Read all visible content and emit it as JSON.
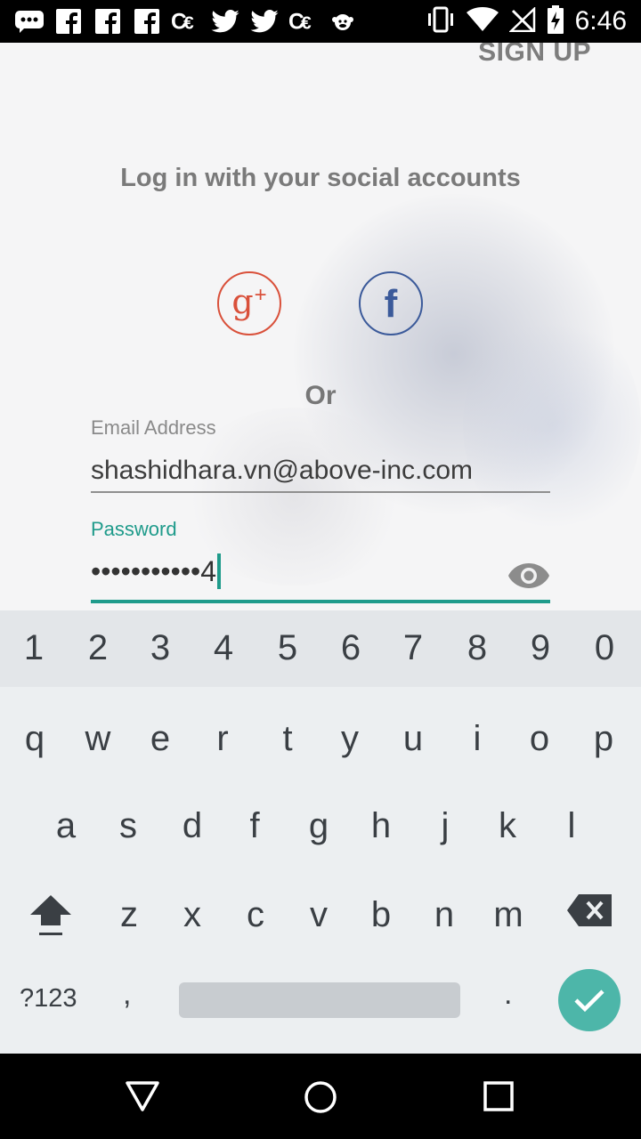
{
  "status_bar": {
    "time": "6:46",
    "left_icons": [
      "message-icon",
      "facebook-notif-icon",
      "facebook-notif-icon",
      "facebook-notif-icon",
      "cc-notif-icon",
      "twitter-icon",
      "twitter-icon",
      "cc-notif-icon",
      "monkey-icon"
    ],
    "right_icons": [
      "vibrate-icon",
      "wifi-icon",
      "no-signal-icon",
      "battery-charging-icon"
    ]
  },
  "header": {
    "signup_label": "SIGN UP"
  },
  "social": {
    "title": "Log in with your social accounts",
    "google_plus_glyph": "g",
    "google_plus_super": "+",
    "facebook_glyph": "f",
    "google_color": "#d9503a",
    "facebook_color": "#3b5a9a"
  },
  "divider_text": "Or",
  "form": {
    "email_label": "Email Address",
    "email_value": "shashidhara.vn@above-inc.com",
    "password_label": "Password",
    "password_masked": "•••••••••••",
    "password_last_char": "4",
    "accent_color": "#1f9b8b"
  },
  "keyboard": {
    "number_row": [
      "1",
      "2",
      "3",
      "4",
      "5",
      "6",
      "7",
      "8",
      "9",
      "0"
    ],
    "row1": [
      "q",
      "w",
      "e",
      "r",
      "t",
      "y",
      "u",
      "i",
      "o",
      "p"
    ],
    "row2": [
      "a",
      "s",
      "d",
      "f",
      "g",
      "h",
      "j",
      "k",
      "l"
    ],
    "row3": [
      "z",
      "x",
      "c",
      "v",
      "b",
      "n",
      "m"
    ],
    "symbols_label": "?123",
    "comma": ",",
    "period": ".",
    "enter_color": "#4db6a9"
  },
  "nav_bar": {
    "buttons": [
      "back-icon",
      "home-icon",
      "recents-icon"
    ]
  }
}
